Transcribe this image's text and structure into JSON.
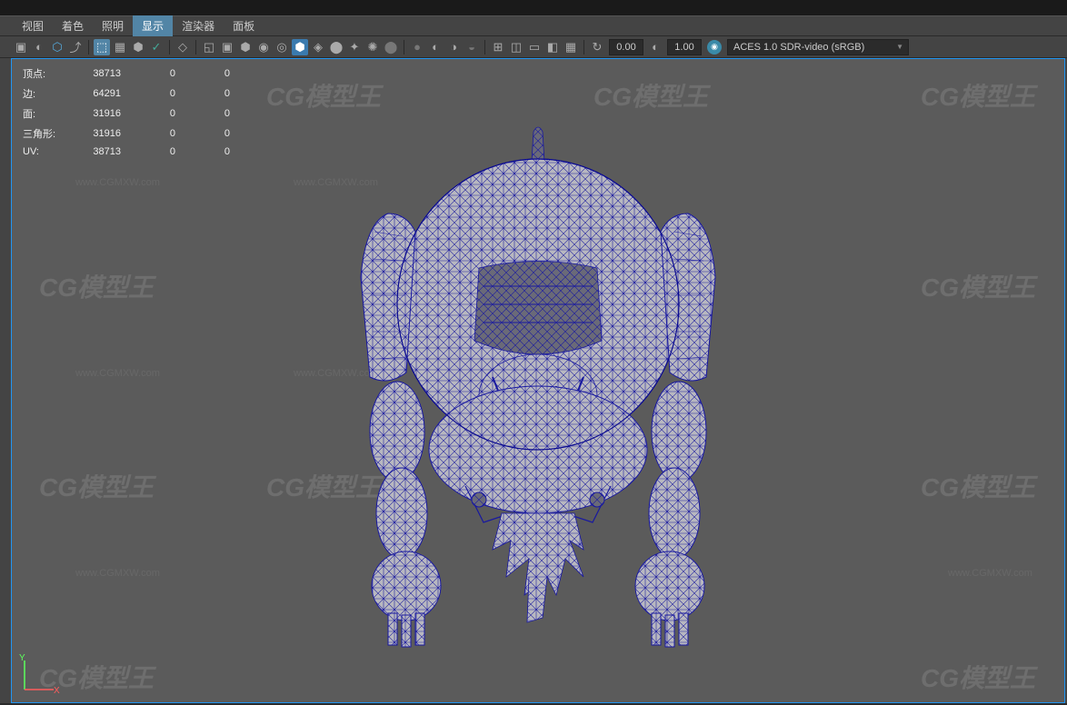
{
  "menu": {
    "view": "视图",
    "shading": "着色",
    "lighting": "照明",
    "display": "显示",
    "renderer": "渲染器",
    "panels": "面板"
  },
  "toolbar": {
    "num1": "0.00",
    "num2": "1.00",
    "colorspace": "ACES 1.0 SDR-video (sRGB)"
  },
  "stats": {
    "verts_label": "顶点:",
    "edges_label": "边:",
    "faces_label": "面:",
    "tris_label": "三角形:",
    "uv_label": "UV:",
    "verts": "38713",
    "edges": "64291",
    "faces": "31916",
    "tris": "31916",
    "uv": "38713",
    "zero": "0"
  },
  "axis": {
    "x": "X",
    "y": "Y"
  },
  "watermark": {
    "logo": "CG模型王",
    "url": "www.CGMXW.com"
  }
}
